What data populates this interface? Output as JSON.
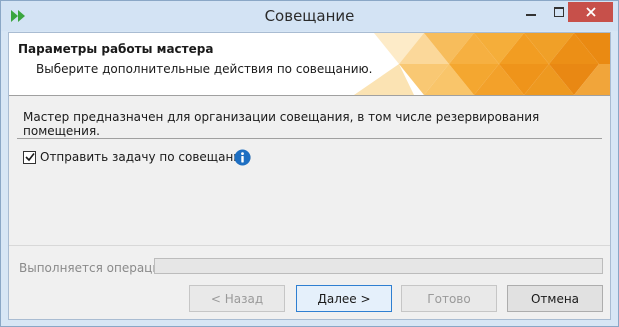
{
  "window": {
    "title": "Совещание",
    "icon": "double-chevron-right-icon"
  },
  "colors": {
    "accent": "#f0a020",
    "info": "#1e6fc2",
    "close_button": "#c7504a"
  },
  "banner": {
    "title": "Параметры работы мастера",
    "subtitle": "Выберите дополнительные действия по совещанию."
  },
  "content": {
    "description": "Мастер предназначен для организации совещания, в том числе  резервирования помещения.",
    "send_task_label": "Отправить задачу по совещанию",
    "send_task_checked": true
  },
  "status": {
    "operation_label": "Выполняется операция",
    "progress": 0
  },
  "buttons": {
    "back": "< Назад",
    "next": "Далее >",
    "finish": "Готово",
    "cancel": "Отмена"
  }
}
